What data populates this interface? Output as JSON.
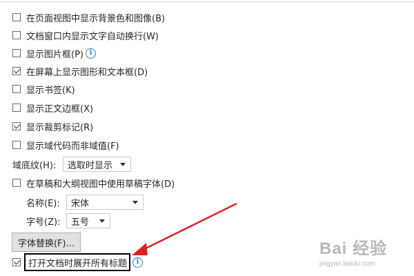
{
  "options": [
    {
      "label": "在页面视图中显示背景色和图像(B)",
      "checked": false
    },
    {
      "label": "文档窗口内显示文字自动换行(W)",
      "checked": false
    },
    {
      "label": "显示图片框(P)",
      "checked": false
    },
    {
      "label": "在屏幕上显示图形和文本框(D)",
      "checked": true
    },
    {
      "label": "显示书签(K)",
      "checked": false
    },
    {
      "label": "显示正文边框(X)",
      "checked": false
    },
    {
      "label": "显示裁剪标记(R)",
      "checked": true
    },
    {
      "label": "显示域代码而非域值(F)",
      "checked": false
    }
  ],
  "field_shading": {
    "label": "域底纹(H):",
    "value": "选取时显示"
  },
  "draft_font": {
    "label": "在草稿和大纲视图中使用草稿字体(D)",
    "checked": false
  },
  "font_name": {
    "label": "名称(E):",
    "value": "宋体"
  },
  "font_size": {
    "label": "字号(Z):",
    "value": "五号"
  },
  "font_substitution_button": "字体替换(F)...",
  "expand_headings": {
    "label": "打开文档时展开所有标题",
    "checked": true
  },
  "info_glyph": "i",
  "annotation": {
    "color": "#e02020"
  },
  "watermark": {
    "main": "Bai 经验",
    "url": "jingyan.baidu.com"
  }
}
